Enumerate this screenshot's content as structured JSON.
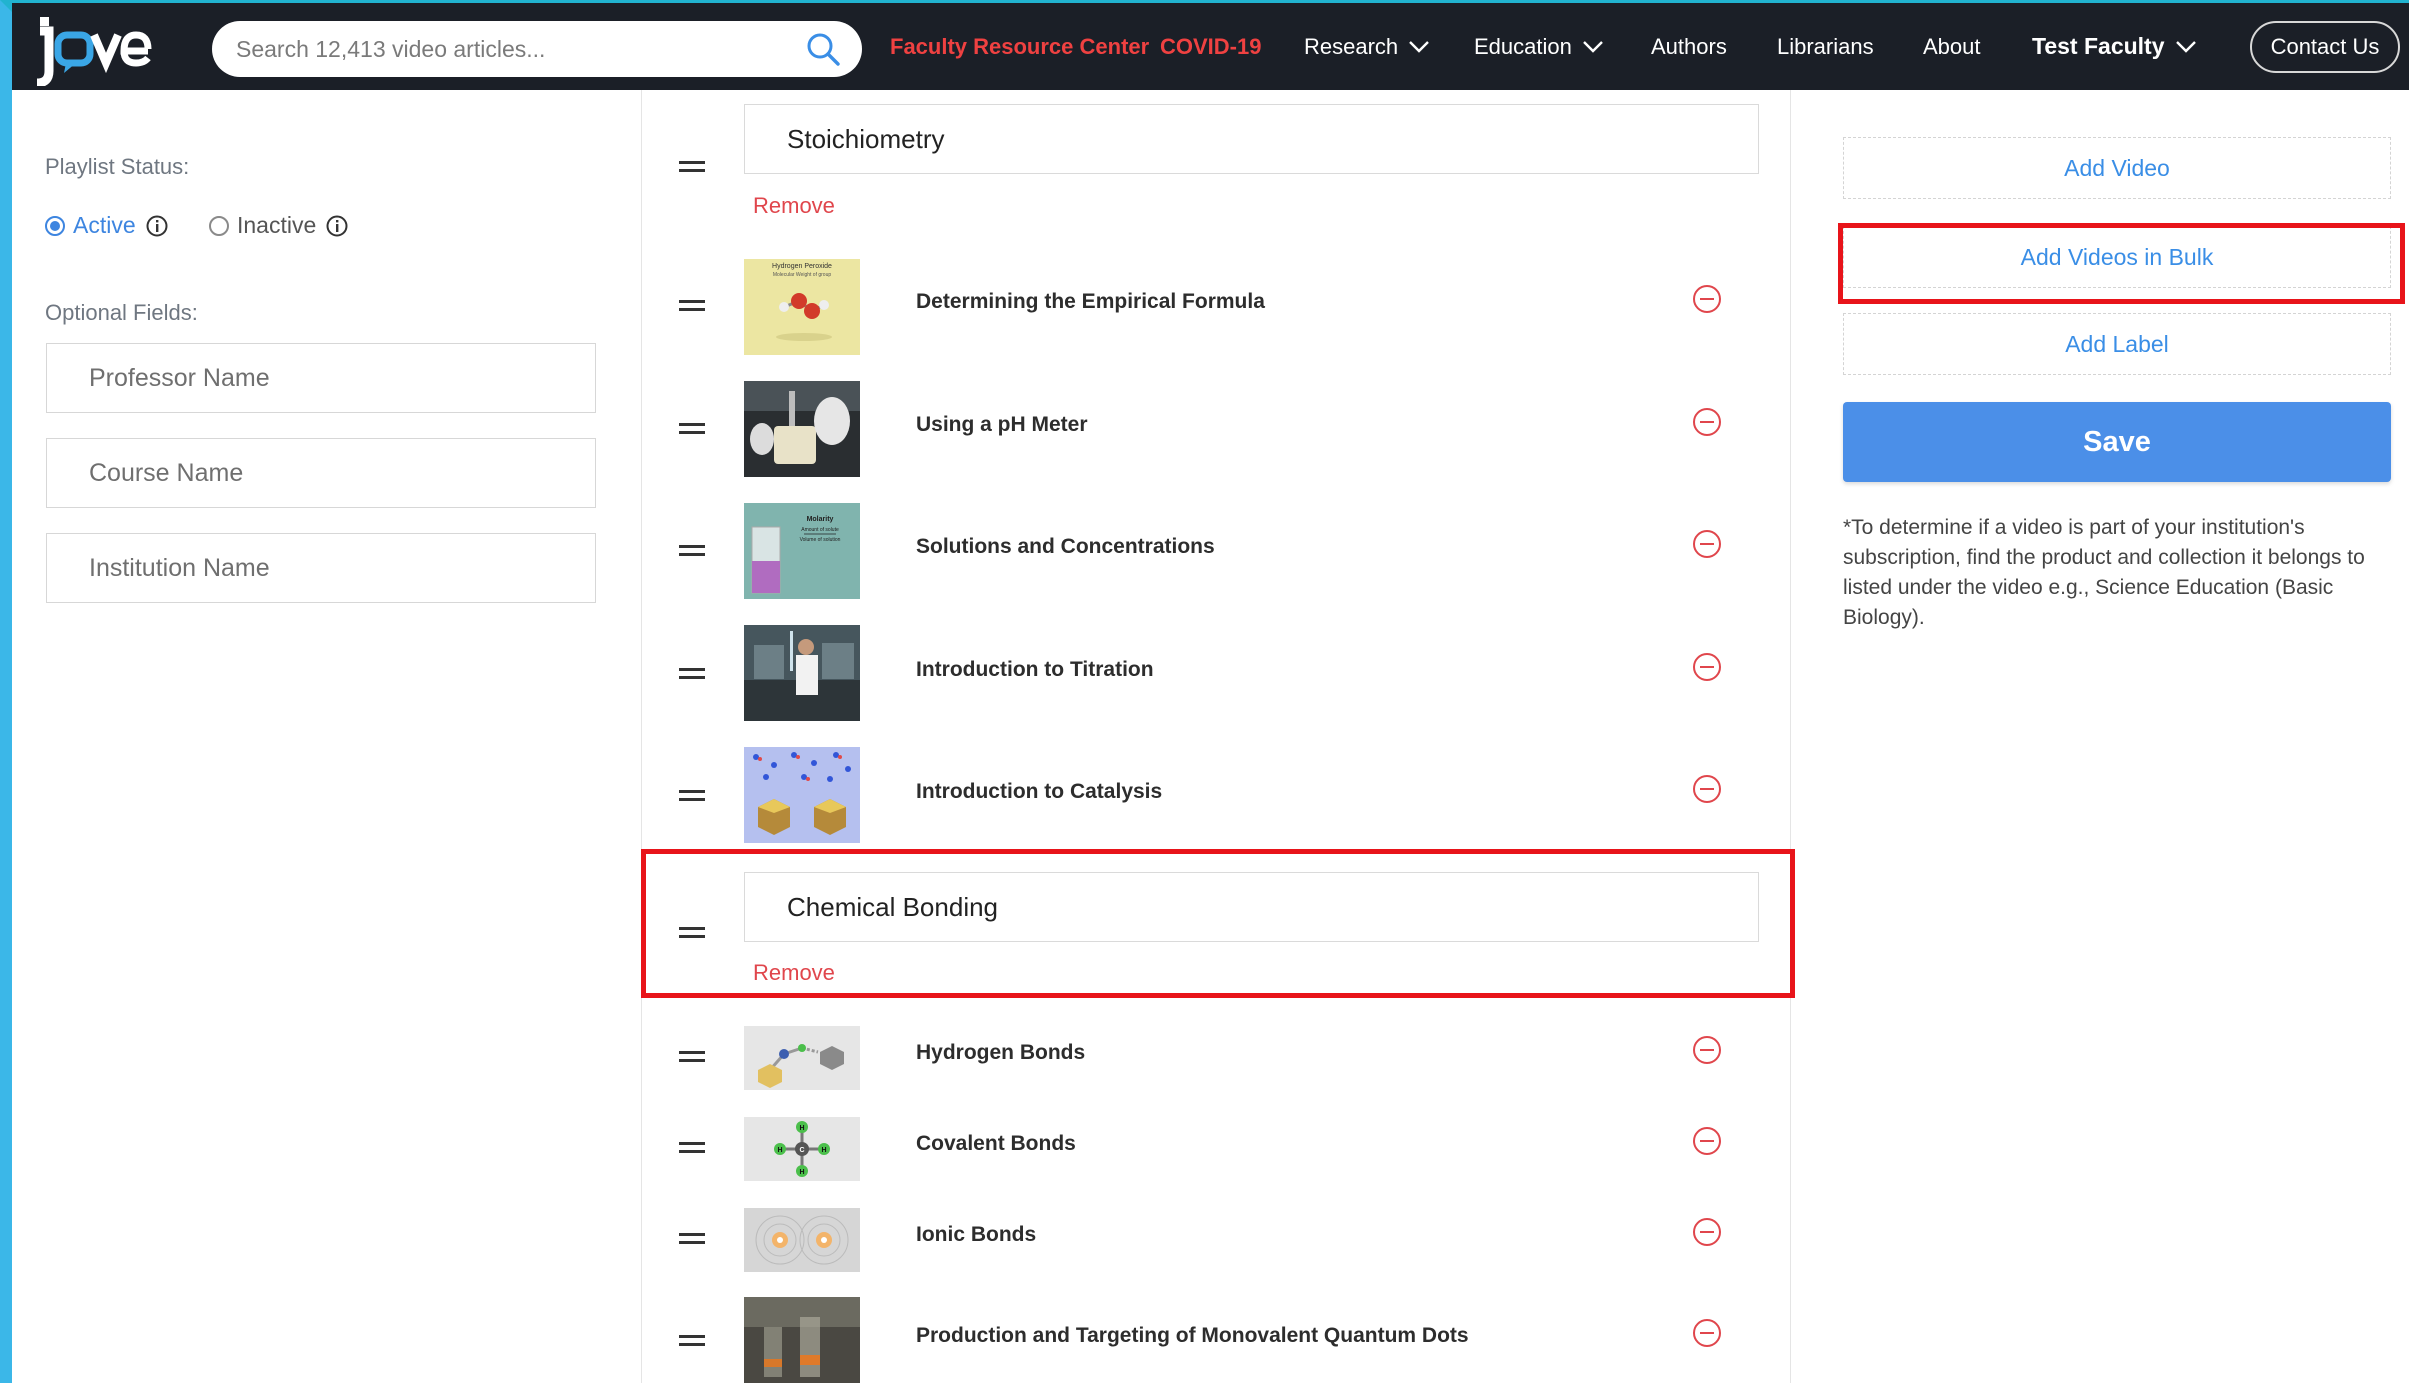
{
  "nav": {
    "search_placeholder": "Search 12,413 video articles...",
    "links": {
      "faculty": "Faculty Resource Center",
      "covid": "COVID-19",
      "research": "Research",
      "education": "Education",
      "authors": "Authors",
      "librarians": "Librarians",
      "about": "About",
      "user": "Test Faculty"
    },
    "contact": "Contact Us"
  },
  "left": {
    "status_label": "Playlist Status:",
    "active": "Active",
    "inactive": "Inactive",
    "optional_label": "Optional Fields:",
    "fields": [
      "Professor Name",
      "Course Name",
      "Institution Name"
    ]
  },
  "sections": [
    {
      "title": "Stoichiometry",
      "remove": "Remove",
      "videos": [
        "Determining the Empirical Formula",
        "Using a pH Meter",
        "Solutions and Concentrations",
        "Introduction to Titration",
        "Introduction to Catalysis"
      ]
    },
    {
      "title": "Chemical Bonding",
      "remove": "Remove",
      "videos": [
        "Hydrogen Bonds",
        "Covalent Bonds",
        "Ionic Bonds",
        "Production and Targeting of Monovalent Quantum Dots"
      ]
    }
  ],
  "thumb_text": {
    "peroxide_title": "Hydrogen Peroxide",
    "peroxide_sub": "Molecular Weight of group",
    "molarity": "Molarity",
    "molarity_sub1": "Amount of solute",
    "molarity_sub2": "Volume of solution",
    "covalent_atoms": [
      "H",
      "H",
      "C",
      "H",
      "H"
    ]
  },
  "right": {
    "add_video": "Add Video",
    "add_bulk": "Add Videos in Bulk",
    "add_label": "Add Label",
    "save": "Save",
    "note": "*To determine if a video is part of your institution's subscription, find the product and collection it belongs to listed under the video e.g., Science Education (Basic Biology)."
  },
  "colors": {
    "nav_bg": "#1b1f27",
    "accent_blue": "#4b8fe8",
    "link_blue": "#3a8ee6",
    "remove_red": "#e0464c",
    "highlight_red": "#e8141a"
  },
  "icons": {
    "search": "search-icon",
    "info": "info-icon",
    "drag": "drag-handle-icon",
    "remove": "minus-circle-icon",
    "chevron": "chevron-down-icon"
  }
}
